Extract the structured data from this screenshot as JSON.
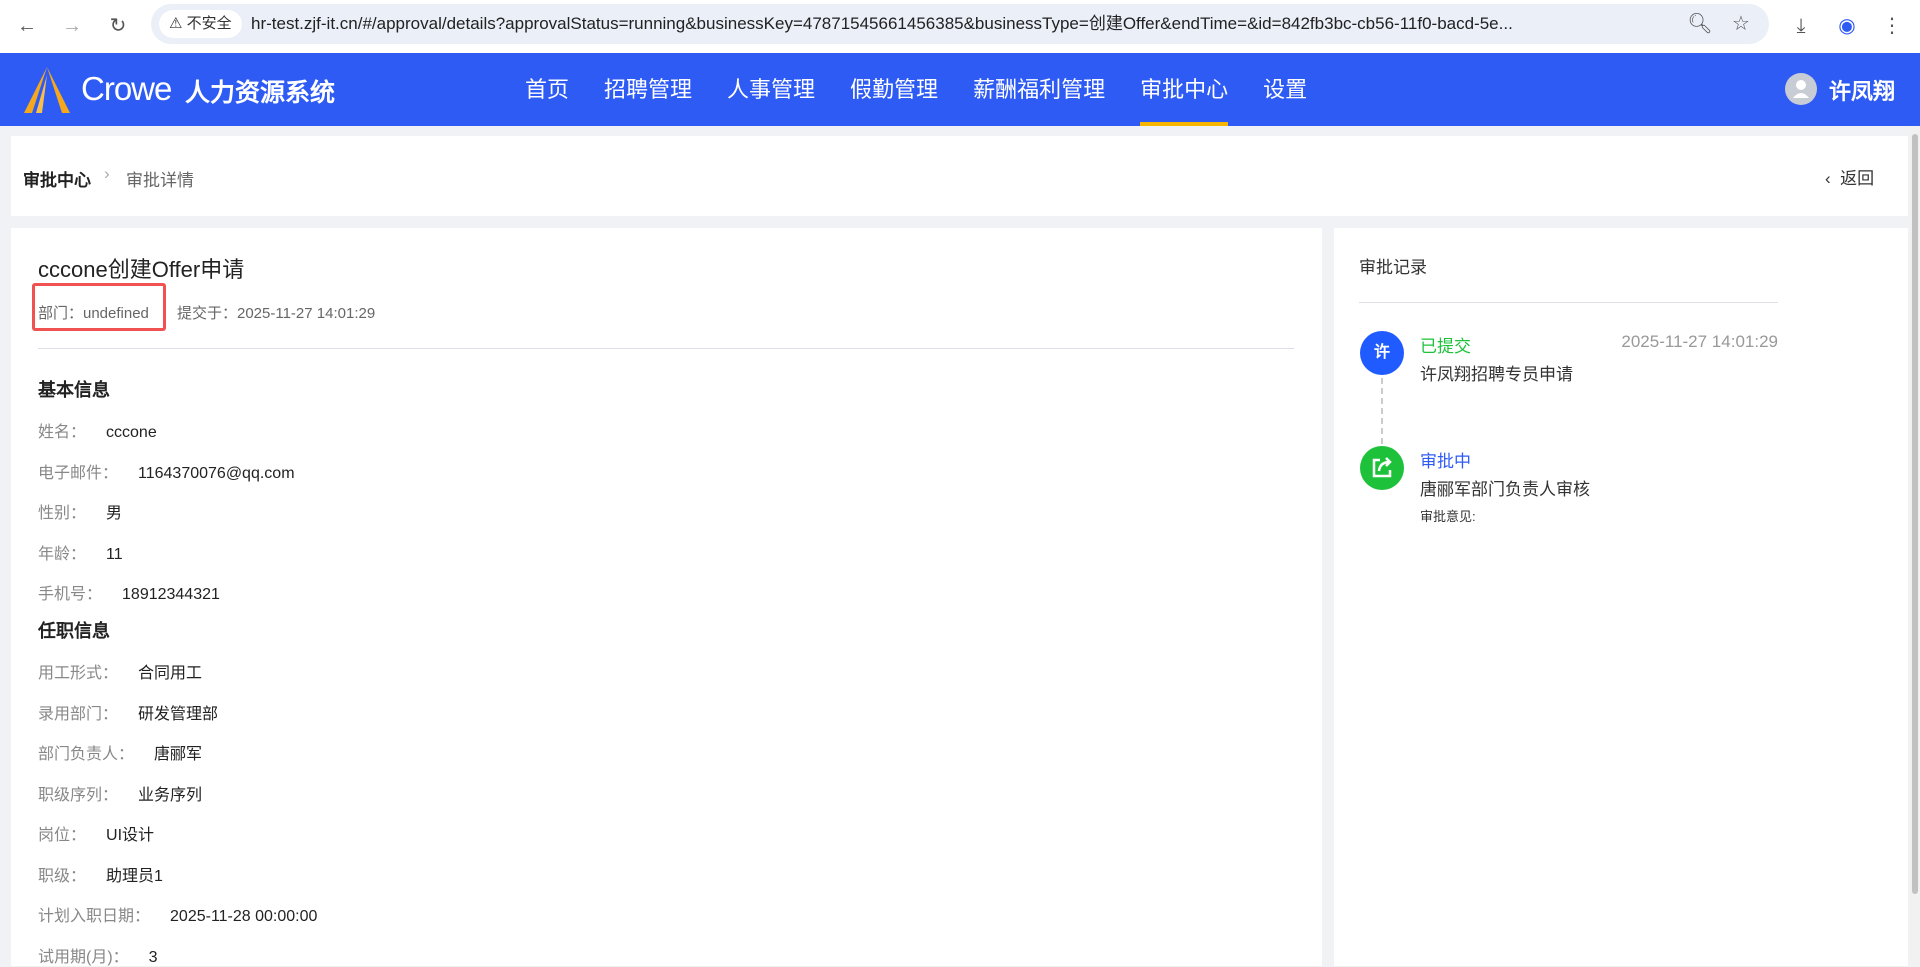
{
  "browser": {
    "security_label": "不安全",
    "url": "hr-test.zjf-it.cn/#/approval/details?approvalStatus=running&businessKey=47871545661456385&businessType=创建Offer&endTime=&id=842fb3bc-cb56-11f0-bacd-5e..."
  },
  "header": {
    "logo_text": "Crowe",
    "system_name": "人力资源系统",
    "user_name": "许凤翔",
    "menu": [
      {
        "label": "首页"
      },
      {
        "label": "招聘管理"
      },
      {
        "label": "人事管理"
      },
      {
        "label": "假勤管理"
      },
      {
        "label": "薪酬福利管理"
      },
      {
        "label": "审批中心",
        "active": true
      },
      {
        "label": "设置"
      }
    ]
  },
  "breadcrumb": {
    "root": "审批中心",
    "current": "审批详情",
    "back": "返回"
  },
  "detail": {
    "title": "cccone创建Offer申请",
    "dept": "部门：undefined",
    "submitted": "提交于：2025-11-27 14:01:29",
    "basic_title": "基本信息",
    "basic": [
      {
        "label": "姓名：",
        "value": "cccone"
      },
      {
        "label": "电子邮件：",
        "value": "1164370076@qq.com"
      },
      {
        "label": "性别：",
        "value": "男"
      },
      {
        "label": "年龄：",
        "value": "11"
      },
      {
        "label": "手机号：",
        "value": "18912344321"
      }
    ],
    "job_title": "任职信息",
    "job": [
      {
        "label": "用工形式：",
        "value": "合同用工"
      },
      {
        "label": "录用部门：",
        "value": "研发管理部"
      },
      {
        "label": "部门负责人：",
        "value": "唐郦军"
      },
      {
        "label": "职级序列：",
        "value": "业务序列"
      },
      {
        "label": "岗位：",
        "value": "UI设计"
      },
      {
        "label": "职级：",
        "value": "助理员1"
      },
      {
        "label": "计划入职日期：",
        "value": "2025-11-28 00:00:00"
      },
      {
        "label": "试用期(月)：",
        "value": "3"
      }
    ]
  },
  "records": {
    "title": "审批记录",
    "items": [
      {
        "avatar": "许",
        "status": "已提交",
        "desc": "许凤翔招聘专员申请",
        "time": "2025-11-27 14:01:29",
        "color": "#1ec23a"
      },
      {
        "status": "审批中",
        "desc": "唐郦军部门负责人审核",
        "opinion": "审批意见:",
        "color": "#2f5bf5"
      }
    ]
  }
}
